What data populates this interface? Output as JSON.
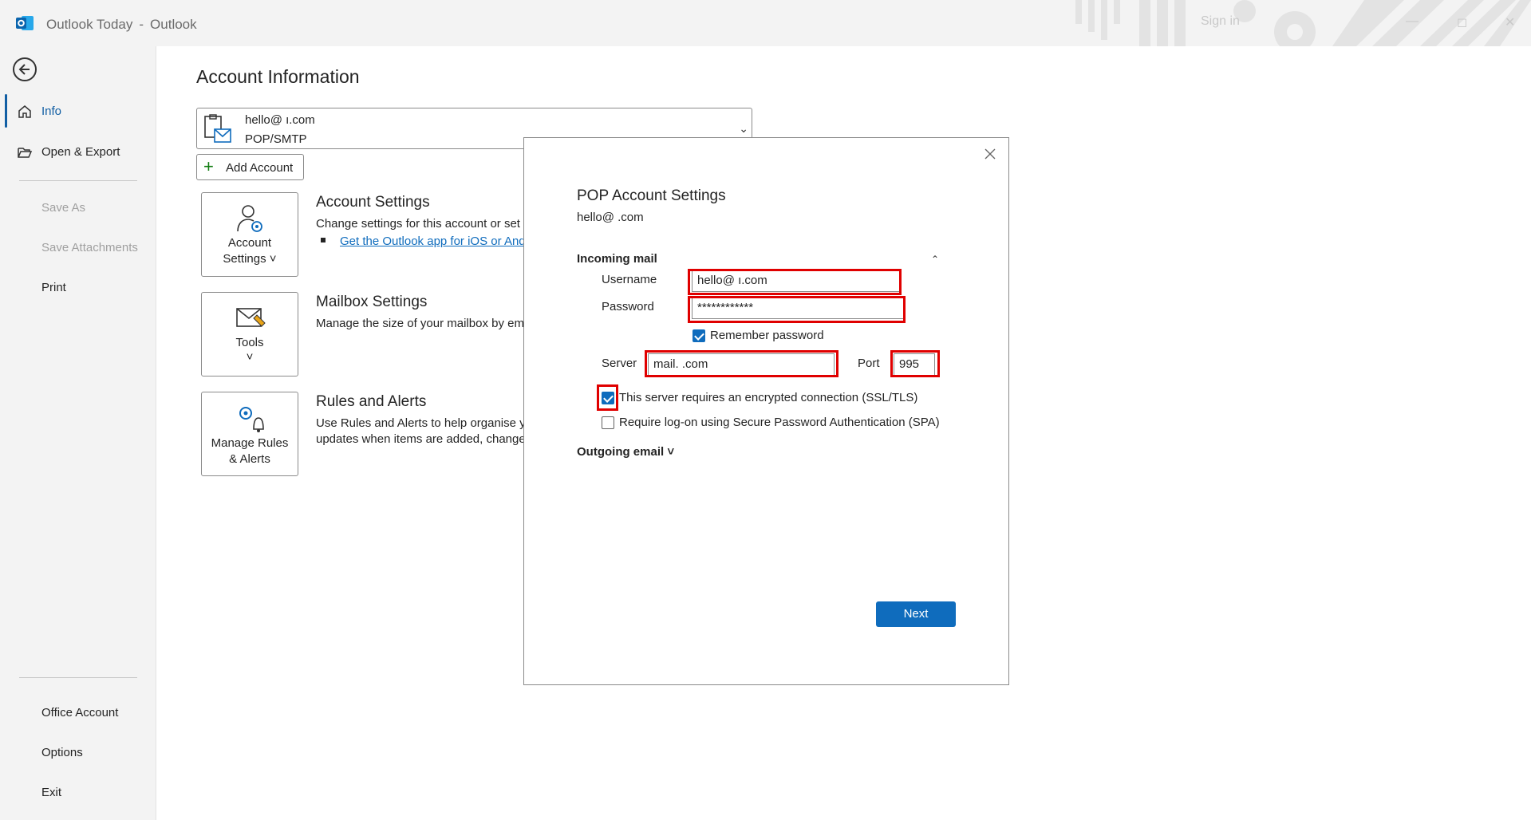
{
  "window": {
    "title": "Outlook Today",
    "app_name": "Outlook",
    "title_separator": "-",
    "sign_in": "Sign in"
  },
  "nav": {
    "items": [
      {
        "label": "Info",
        "state": "active"
      },
      {
        "label": "Open & Export",
        "state": "normal"
      },
      {
        "label": "Save As",
        "state": "disabled"
      },
      {
        "label": "Save Attachments",
        "state": "disabled"
      },
      {
        "label": "Print",
        "state": "normal"
      }
    ],
    "bottom_items": [
      {
        "label": "Office Account"
      },
      {
        "label": "Options"
      },
      {
        "label": "Exit"
      }
    ]
  },
  "main": {
    "title": "Account Information",
    "account": {
      "email": "hello@                    ı.com",
      "type": "POP/SMTP"
    },
    "add_account_label": "Add Account",
    "sections": [
      {
        "tile_label_1": "Account",
        "tile_label_2": "Settings ˅",
        "title": "Account Settings",
        "desc": "Change settings for this account or set u",
        "link": "Get the Outlook app for iOS or And"
      },
      {
        "tile_label_1": "Tools",
        "tile_label_2": "˅",
        "title": "Mailbox Settings",
        "desc": "Manage the size of your mailbox by em"
      },
      {
        "tile_label_1": "Manage Rules",
        "tile_label_2": "& Alerts",
        "title": "Rules and Alerts",
        "desc_1": "Use Rules and Alerts to help organise yo",
        "desc_2": "updates when items are added, change"
      }
    ]
  },
  "dialog": {
    "title": "POP Account Settings",
    "email": "hello@                  .com",
    "incoming_header": "Incoming mail",
    "username_label": "Username",
    "username_value": "hello@                  ı.com",
    "password_label": "Password",
    "password_value": "************",
    "remember_label": "Remember password",
    "remember_checked": true,
    "server_label": "Server",
    "server_value": "mail.                   .com",
    "port_label": "Port",
    "port_value": "995",
    "ssl_label": "This server requires an encrypted connection (SSL/TLS)",
    "ssl_checked": true,
    "spa_label": "Require log-on using Secure Password Authentication (SPA)",
    "spa_checked": false,
    "outgoing_header": "Outgoing email ˅",
    "next_label": "Next"
  },
  "colors": {
    "accent": "#0f6cbd",
    "highlight": "#e00000"
  }
}
